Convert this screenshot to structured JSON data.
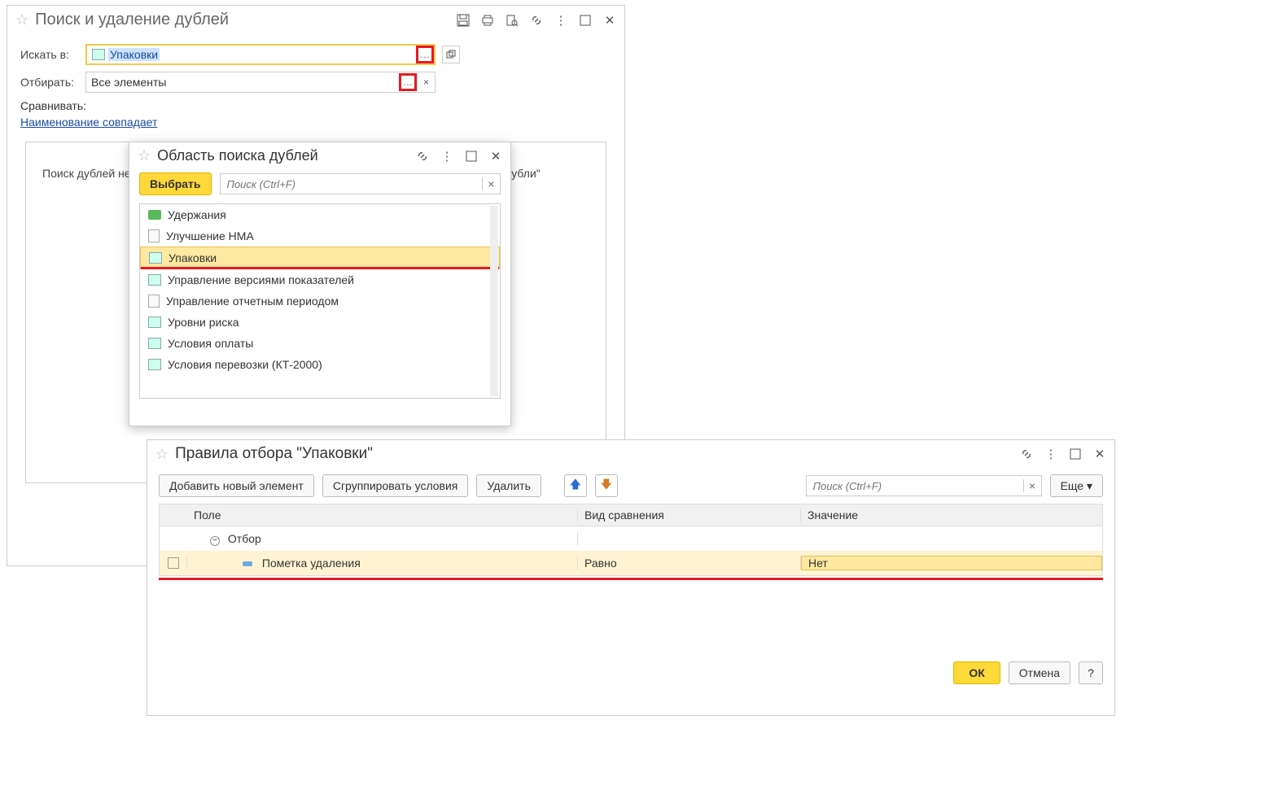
{
  "win1": {
    "title": "Поиск и удаление дублей",
    "search_label": "Искать в:",
    "search_value": "Упаковки",
    "filter_label": "Отбирать:",
    "filter_value": "Все элементы",
    "compare_label": "Сравнивать:",
    "compare_link": "Наименование совпадает",
    "hint": "Поиск дублей не выполнялся. Задайте условие отбора и сравнения и нажмите \"Найти дубли\""
  },
  "win2": {
    "title": "Область поиска дублей",
    "select_btn": "Выбрать",
    "search_ph": "Поиск (Ctrl+F)",
    "items": [
      {
        "label": "Удержания",
        "type": "grp"
      },
      {
        "label": "Улучшение НМА",
        "type": "doc"
      },
      {
        "label": "Упаковки",
        "type": "cat",
        "selected": true
      },
      {
        "label": "Управление версиями показателей",
        "type": "cat"
      },
      {
        "label": "Управление отчетным периодом",
        "type": "doc"
      },
      {
        "label": "Уровни риска",
        "type": "cat"
      },
      {
        "label": "Условия оплаты",
        "type": "cat"
      },
      {
        "label": "Условия перевозки (КТ-2000)",
        "type": "cat"
      }
    ]
  },
  "win3": {
    "title": "Правила отбора \"Упаковки\"",
    "add_btn": "Добавить новый элемент",
    "group_btn": "Сгруппировать условия",
    "del_btn": "Удалить",
    "more_btn": "Еще",
    "search_ph": "Поиск (Ctrl+F)",
    "cols": {
      "field": "Поле",
      "comp": "Вид сравнения",
      "val": "Значение"
    },
    "group_label": "Отбор",
    "row": {
      "field": "Пометка удаления",
      "comp": "Равно",
      "val": "Нет"
    },
    "ok": "ОК",
    "cancel": "Отмена",
    "help": "?"
  }
}
